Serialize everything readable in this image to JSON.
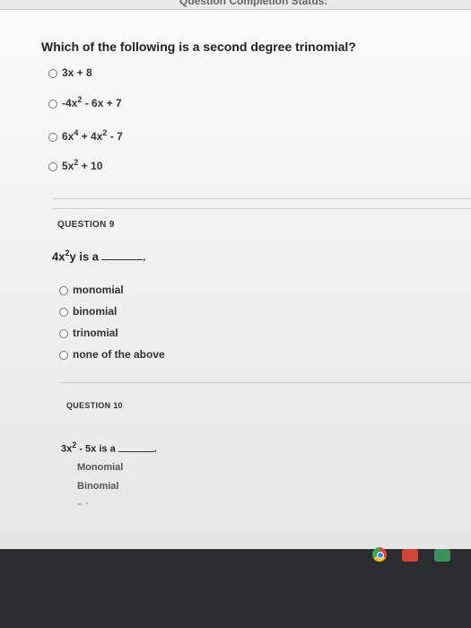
{
  "header": {
    "partial_title": "Question Completion Status:"
  },
  "question8": {
    "title": "Which of the following is a second degree trinomial?",
    "options": [
      {
        "pre": "3x + 8",
        "sup": "",
        "post": ""
      },
      {
        "pre": "-4x",
        "sup": "2",
        "post": " - 6x + 7"
      },
      {
        "pre": "6x",
        "sup": "4",
        "mid": " + 4x",
        "sup2": "2",
        "post": " - 7"
      },
      {
        "pre": "5x",
        "sup": "2",
        "post": " + 10"
      }
    ]
  },
  "question9": {
    "label": "QUESTION 9",
    "stem_pre": "4x",
    "stem_sup": "2",
    "stem_post": "y is a",
    "stem_end": ".",
    "options": [
      "monomial",
      "binomial",
      "trinomial",
      "none of the above"
    ]
  },
  "question10": {
    "label": "QUESTION 10",
    "stem_pre": "3x",
    "stem_sup": "2",
    "stem_post": " - 5x is a",
    "stem_end": ".",
    "options": [
      "Monomial",
      "Binomial"
    ]
  }
}
